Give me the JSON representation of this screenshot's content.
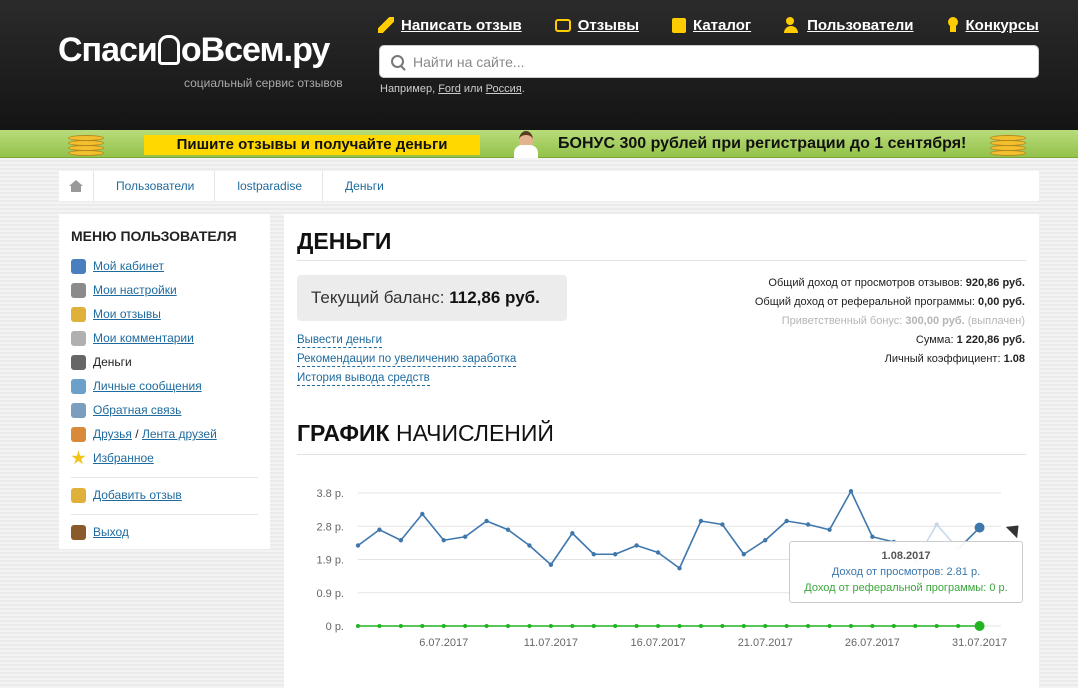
{
  "header": {
    "logo_main": "СпасибоВсем.ру",
    "logo_sub": "социальный сервис отзывов",
    "nav": [
      {
        "label": "Написать отзыв",
        "icon": "pen-icon"
      },
      {
        "label": "Отзывы",
        "icon": "reviews-icon"
      },
      {
        "label": "Каталог",
        "icon": "catalog-icon"
      },
      {
        "label": "Пользователи",
        "icon": "users-icon"
      },
      {
        "label": "Конкурсы",
        "icon": "medal-icon"
      }
    ],
    "search": {
      "placeholder": "Найти на сайте...",
      "hint_prefix": "Например,",
      "hint_link1": "Ford",
      "hint_mid": "или",
      "hint_link2": "Россия",
      "hint_suffix": "."
    }
  },
  "banner": {
    "left_text": "Пишите отзывы и получайте деньги",
    "right_text": "БОНУС 300 рублей при регистрации до 1 сентября!"
  },
  "breadcrumb": [
    "Пользователи",
    "lostparadise",
    "Деньги"
  ],
  "sidebar": {
    "title": "МЕНЮ ПОЛЬЗОВАТЕЛЯ",
    "items": [
      {
        "label": "Мой кабинет",
        "icon": "user-icon",
        "color": "#4a7fbf"
      },
      {
        "label": "Мои настройки",
        "icon": "settings-icon",
        "color": "#8b8b8b"
      },
      {
        "label": "Мои отзывы",
        "icon": "reviews-icon",
        "color": "#e0b13a"
      },
      {
        "label": "Мои комментарии",
        "icon": "comments-icon",
        "color": "#b0b0b0"
      },
      {
        "label": "Деньги",
        "icon": "money-icon",
        "color": "#666666"
      },
      {
        "label": "Личные сообщения",
        "icon": "messages-icon",
        "color": "#6aa0c9"
      },
      {
        "label": "Обратная связь",
        "icon": "feedback-icon",
        "color": "#7b9dc0"
      },
      {
        "label": "Друзья",
        "label2": "Лента друзей",
        "icon": "friends-icon",
        "color": "#d8893a"
      },
      {
        "label": "Избранное",
        "icon": "star-icon",
        "color": "#f0c419"
      }
    ],
    "add_review": "Добавить отзыв",
    "logout": "Выход"
  },
  "main": {
    "title": "ДЕНЬГИ",
    "balance_label": "Текущий баланс:",
    "balance_value": "112,86 руб.",
    "links": [
      "Вывести деньги",
      "Рекомендации по увеличению заработка",
      "История вывода средств"
    ],
    "stats": [
      {
        "label": "Общий доход от просмотров отзывов:",
        "value": "920,86 руб.",
        "suffix": ""
      },
      {
        "label": "Общий доход от реферальной программы:",
        "value": "0,00 руб.",
        "suffix": ""
      },
      {
        "label": "Приветственный бонус:",
        "value": "300,00 руб.",
        "suffix": "(выплачен)",
        "muted": true
      },
      {
        "label": "Сумма:",
        "value": "1 220,86 руб.",
        "suffix": ""
      },
      {
        "label": "Личный коэффициент:",
        "value": "1.08",
        "suffix": ""
      }
    ],
    "chart_title_bold": "ГРАФИК",
    "chart_title_rest": "НАЧИСЛЕНИЙ"
  },
  "chart_data": {
    "type": "line",
    "title": "ГРАФИК НАЧИСЛЕНИЙ",
    "y_ticks": [
      "0 р.",
      "0.9 р.",
      "1.9 р.",
      "2.8 р.",
      "3.8 р."
    ],
    "y_tick_values": [
      0,
      0.95,
      1.9,
      2.85,
      3.8
    ],
    "ylim": [
      0,
      3.8
    ],
    "x_tick_labels": [
      "6.07.2017",
      "11.07.2017",
      "16.07.2017",
      "21.07.2017",
      "26.07.2017",
      "31.07.2017"
    ],
    "x_tick_index": [
      4,
      9,
      14,
      19,
      24,
      29
    ],
    "x": [
      "2.07.2017",
      "3.07.2017",
      "4.07.2017",
      "5.07.2017",
      "6.07.2017",
      "7.07.2017",
      "8.07.2017",
      "9.07.2017",
      "10.07.2017",
      "11.07.2017",
      "12.07.2017",
      "13.07.2017",
      "14.07.2017",
      "15.07.2017",
      "16.07.2017",
      "17.07.2017",
      "18.07.2017",
      "19.07.2017",
      "20.07.2017",
      "21.07.2017",
      "22.07.2017",
      "23.07.2017",
      "24.07.2017",
      "25.07.2017",
      "26.07.2017",
      "27.07.2017",
      "28.07.2017",
      "29.07.2017",
      "30.07.2017",
      "31.07.2017",
      "1.08.2017"
    ],
    "series": [
      {
        "name": "Доход от просмотров",
        "color": "#3f77ad",
        "values": [
          2.3,
          2.75,
          2.45,
          3.2,
          2.45,
          2.55,
          3.0,
          2.75,
          2.3,
          1.75,
          2.65,
          2.05,
          2.05,
          2.3,
          2.1,
          1.65,
          3.0,
          2.9,
          2.05,
          2.45,
          3.0,
          2.9,
          2.75,
          3.85,
          2.55,
          2.4,
          1.85,
          2.9,
          2.2,
          2.81
        ]
      },
      {
        "name": "Доход от реферальной программы",
        "color": "#22b322",
        "values": [
          0,
          0,
          0,
          0,
          0,
          0,
          0,
          0,
          0,
          0,
          0,
          0,
          0,
          0,
          0,
          0,
          0,
          0,
          0,
          0,
          0,
          0,
          0,
          0,
          0,
          0,
          0,
          0,
          0,
          0
        ]
      }
    ],
    "faded_range": [
      25,
      28
    ],
    "tooltip": {
      "date": "1.08.2017",
      "views_label": "Доход от просмотров:",
      "views_value": "2.81 р.",
      "ref_label": "Доход от реферальной программы:",
      "ref_value": "0 р."
    }
  }
}
